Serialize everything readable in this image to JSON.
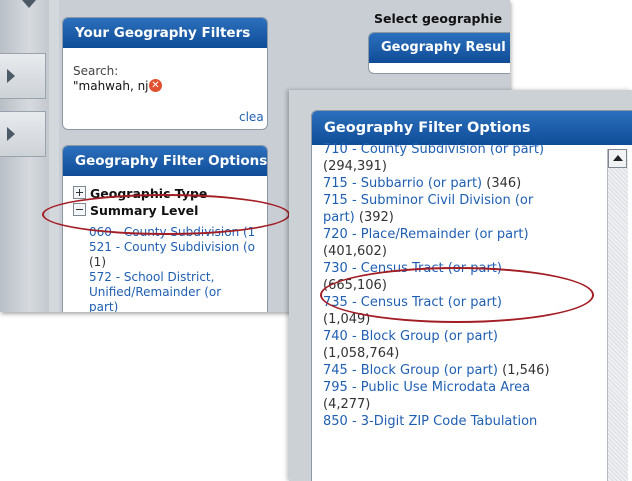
{
  "left_panel": {
    "your_filters": {
      "title": "Your Geography Filters",
      "search_label": "Search:",
      "search_value": "\"mahwah, nj \"",
      "clear_label": "clea"
    },
    "filter_options": {
      "title": "Geography Filter Options",
      "tree": [
        {
          "label": "Geographic Type",
          "state": "collapsed"
        },
        {
          "label": "Summary Level",
          "state": "expanded"
        }
      ],
      "summary_items": [
        {
          "text": "060 - County Subdivision (1",
          "count": ""
        },
        {
          "text": "521 - County Subdivision (o",
          "count": "(1)"
        },
        {
          "text": "572 - School District, Unified/Remainder (or part)",
          "count": ""
        }
      ]
    },
    "right_header": "Select geographie",
    "results_box_title": "Geography Resul"
  },
  "zoom_panel": {
    "title": "Geography Filter Options",
    "items": [
      {
        "label": "710 - County Subdivision (or part)",
        "count": "(294,391)"
      },
      {
        "label": "715 - Subbarrio (or part)",
        "count": "(346)"
      },
      {
        "label": "715 - Subminor Civil Division (or part)",
        "count": "(392)"
      },
      {
        "label": "720 - Place/Remainder (or part)",
        "count": "(401,602)"
      },
      {
        "label": "730 - Census Tract (or part)",
        "count": "(665,106)"
      },
      {
        "label": "735 - Census Tract (or part)",
        "count": "(1,049)"
      },
      {
        "label": "740 - Block Group (or part)",
        "count": "(1,058,764)"
      },
      {
        "label": "745 - Block Group (or part)",
        "count": "(1,546)"
      },
      {
        "label": "795 - Public Use Microdata Area",
        "count": "(4,277)"
      },
      {
        "label": "850 - 3-Digit ZIP Code Tabulation",
        "count": ""
      }
    ]
  },
  "colors": {
    "header_blue": "#1759a8",
    "link_blue": "#1f5fb3",
    "highlight_red": "#a31d24",
    "remove_orange": "#e0512f"
  }
}
